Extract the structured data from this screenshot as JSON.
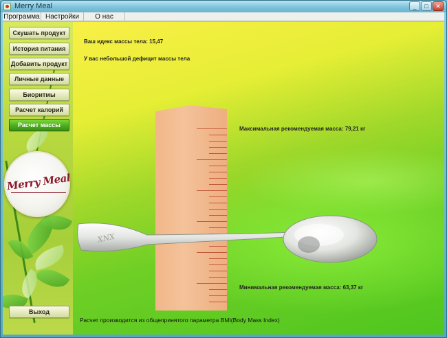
{
  "window": {
    "title": "Merry Meal",
    "controls": {
      "minimize": "_",
      "maximize": "□",
      "close": "✕"
    }
  },
  "menu": {
    "items": [
      "Программа",
      "Настройки",
      "О нас"
    ]
  },
  "sidebar": {
    "items": [
      {
        "label": "Скушать продукт",
        "active": false
      },
      {
        "label": "История  питания",
        "active": false
      },
      {
        "label": "Добавить продукт",
        "active": false
      },
      {
        "label": "Личные данные",
        "active": false
      },
      {
        "label": "Биоритмы",
        "active": false
      },
      {
        "label": "Расчет калорий",
        "active": false
      },
      {
        "label": "Расчет массы",
        "active": true
      }
    ],
    "exit_label": "Выход",
    "logo_text": "Merry Meal"
  },
  "main": {
    "bmi_line": "Ваш идекс массы тела: 15,47",
    "verdict": "У вас небольшой дефицит массы тела",
    "max_mass": "Максимальная рекомендуемая масса: 79,21 кг",
    "min_mass": "Минимальная рекомендуемая масса: 63,37 кг",
    "footnote": "Расчет производится из общепринятого параметра BMI(Body Mass Index)"
  },
  "colors": {
    "active_button": "#4fae1f",
    "ruler": "#f4c29a",
    "ruler_ticks": "#c0573a",
    "logo_text": "#8c1b2a"
  }
}
